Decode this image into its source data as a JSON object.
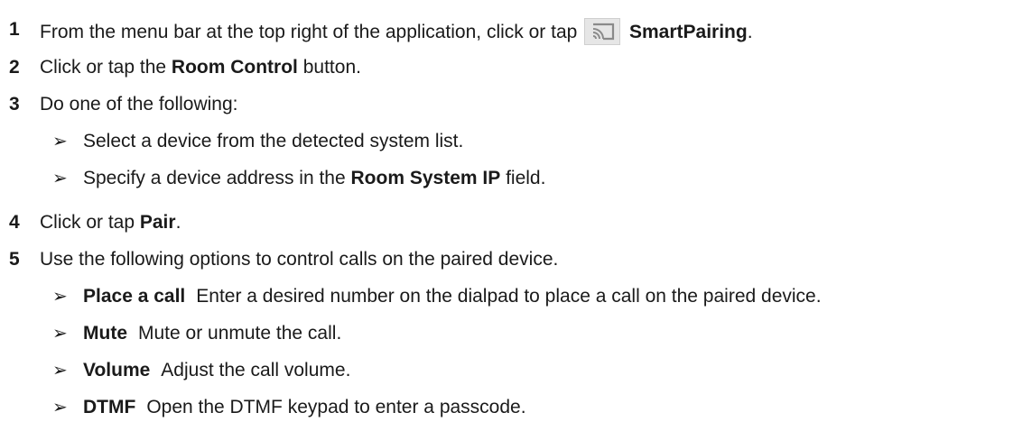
{
  "steps": [
    {
      "number": "1",
      "text_before": "From the menu bar at the top right of the application, click or tap",
      "icon": "smartpairing-cast-icon",
      "bold": "SmartPairing",
      "text_after": "."
    },
    {
      "number": "2",
      "text_before": "Click or tap the",
      "bold": "Room Control",
      "text_after": "button."
    },
    {
      "number": "3",
      "text": "Do one of the following:",
      "options": [
        {
          "text": "Select a device from the detected system list."
        },
        {
          "text_before": "Specify a device address in the",
          "bold": "Room System IP",
          "text_after": "field."
        }
      ]
    },
    {
      "number": "4",
      "text_before": "Click or tap",
      "bold": "Pair",
      "text_after": "."
    },
    {
      "number": "5",
      "text": "Use the following options to control calls on the paired device.",
      "options": [
        {
          "term": "Place a call",
          "description": "Enter a desired number on the dialpad to place a call on the paired device."
        },
        {
          "term": "Mute",
          "description": "Mute or unmute the call."
        },
        {
          "term": "Volume",
          "description": "Adjust the call volume."
        },
        {
          "term": "DTMF",
          "description": "Open the DTMF keypad to enter a passcode."
        }
      ]
    }
  ],
  "bullet_glyph": "➢"
}
